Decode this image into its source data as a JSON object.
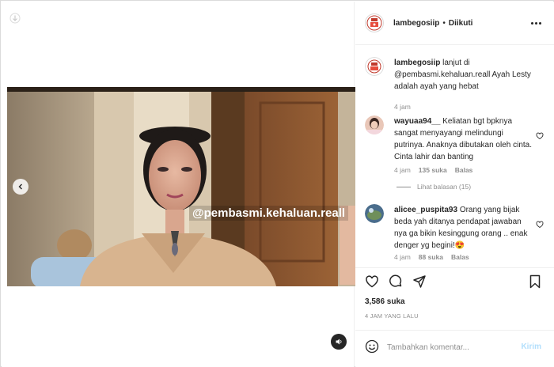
{
  "accent_colors": {
    "link_disabled": "#b2dffc",
    "text_primary": "#262626",
    "text_secondary": "#8e8e8e",
    "heart_emoji": "#f4b400"
  },
  "media": {
    "watermark": "@pembasmi.kehaluan.reall",
    "icons": {
      "corner": "download-icon",
      "prev": "chevron-left-icon",
      "sound": "speaker-icon"
    }
  },
  "header": {
    "username": "lambegosiip",
    "separator": "•",
    "follow_label": "Diikuti",
    "more_icon": "more-horizontal-icon"
  },
  "caption": {
    "username": "lambegosiip",
    "text": "lanjut di @pembasmi.kehaluan.reall Ayah Lesty adalah ayah yang hebat",
    "time": "4 jam"
  },
  "comments": [
    {
      "username": "wayuaa94__",
      "text": "Keliatan bgt bpknya sangat menyayangi melindungi putrinya. Anaknya dibutakan oleh cinta. Cinta lahir dan banting",
      "time": "4 jam",
      "likes": "135 suka",
      "reply_label": "Balas"
    },
    {
      "username": "alicee_puspita93",
      "text": "Orang yang bijak beda yah ditanya pendapat jawaban nya ga bikin kesinggung orang .. enak denger yg begini!",
      "emoji": "😍",
      "time": "4 jam",
      "likes": "88 suka",
      "reply_label": "Balas"
    }
  ],
  "view_replies": "Lihat balasan (15)",
  "actions": {
    "icons": [
      "heart-icon",
      "comment-icon",
      "share-icon",
      "bookmark-icon"
    ],
    "likes": "3,586 suka",
    "time": "4 JAM YANG LALU"
  },
  "composer": {
    "placeholder": "Tambahkan komentar...",
    "post_label": "Kirim",
    "emoji_icon": "smiley-icon"
  }
}
